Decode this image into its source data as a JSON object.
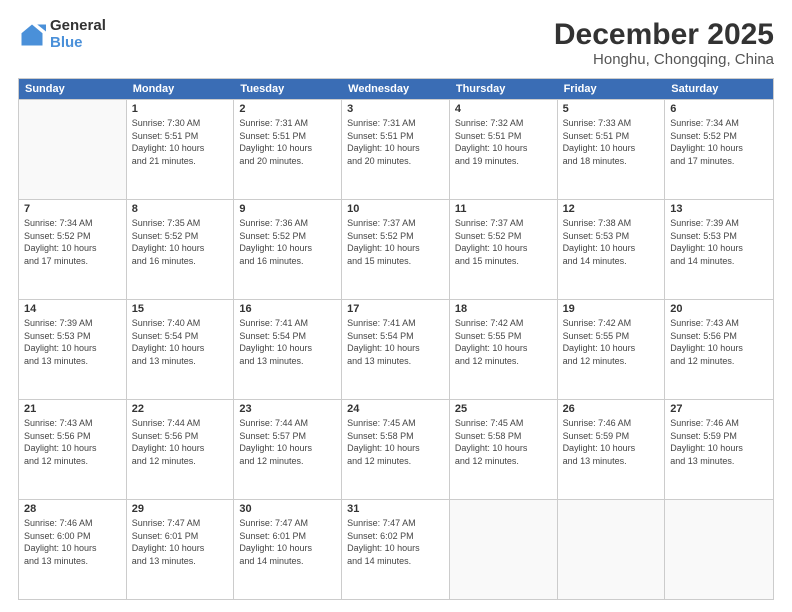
{
  "logo": {
    "general": "General",
    "blue": "Blue"
  },
  "header": {
    "title": "December 2025",
    "subtitle": "Honghu, Chongqing, China"
  },
  "weekdays": [
    "Sunday",
    "Monday",
    "Tuesday",
    "Wednesday",
    "Thursday",
    "Friday",
    "Saturday"
  ],
  "weeks": [
    [
      {
        "day": "",
        "info": ""
      },
      {
        "day": "1",
        "info": "Sunrise: 7:30 AM\nSunset: 5:51 PM\nDaylight: 10 hours\nand 21 minutes."
      },
      {
        "day": "2",
        "info": "Sunrise: 7:31 AM\nSunset: 5:51 PM\nDaylight: 10 hours\nand 20 minutes."
      },
      {
        "day": "3",
        "info": "Sunrise: 7:31 AM\nSunset: 5:51 PM\nDaylight: 10 hours\nand 20 minutes."
      },
      {
        "day": "4",
        "info": "Sunrise: 7:32 AM\nSunset: 5:51 PM\nDaylight: 10 hours\nand 19 minutes."
      },
      {
        "day": "5",
        "info": "Sunrise: 7:33 AM\nSunset: 5:51 PM\nDaylight: 10 hours\nand 18 minutes."
      },
      {
        "day": "6",
        "info": "Sunrise: 7:34 AM\nSunset: 5:52 PM\nDaylight: 10 hours\nand 17 minutes."
      }
    ],
    [
      {
        "day": "7",
        "info": "Sunrise: 7:34 AM\nSunset: 5:52 PM\nDaylight: 10 hours\nand 17 minutes."
      },
      {
        "day": "8",
        "info": "Sunrise: 7:35 AM\nSunset: 5:52 PM\nDaylight: 10 hours\nand 16 minutes."
      },
      {
        "day": "9",
        "info": "Sunrise: 7:36 AM\nSunset: 5:52 PM\nDaylight: 10 hours\nand 16 minutes."
      },
      {
        "day": "10",
        "info": "Sunrise: 7:37 AM\nSunset: 5:52 PM\nDaylight: 10 hours\nand 15 minutes."
      },
      {
        "day": "11",
        "info": "Sunrise: 7:37 AM\nSunset: 5:52 PM\nDaylight: 10 hours\nand 15 minutes."
      },
      {
        "day": "12",
        "info": "Sunrise: 7:38 AM\nSunset: 5:53 PM\nDaylight: 10 hours\nand 14 minutes."
      },
      {
        "day": "13",
        "info": "Sunrise: 7:39 AM\nSunset: 5:53 PM\nDaylight: 10 hours\nand 14 minutes."
      }
    ],
    [
      {
        "day": "14",
        "info": "Sunrise: 7:39 AM\nSunset: 5:53 PM\nDaylight: 10 hours\nand 13 minutes."
      },
      {
        "day": "15",
        "info": "Sunrise: 7:40 AM\nSunset: 5:54 PM\nDaylight: 10 hours\nand 13 minutes."
      },
      {
        "day": "16",
        "info": "Sunrise: 7:41 AM\nSunset: 5:54 PM\nDaylight: 10 hours\nand 13 minutes."
      },
      {
        "day": "17",
        "info": "Sunrise: 7:41 AM\nSunset: 5:54 PM\nDaylight: 10 hours\nand 13 minutes."
      },
      {
        "day": "18",
        "info": "Sunrise: 7:42 AM\nSunset: 5:55 PM\nDaylight: 10 hours\nand 12 minutes."
      },
      {
        "day": "19",
        "info": "Sunrise: 7:42 AM\nSunset: 5:55 PM\nDaylight: 10 hours\nand 12 minutes."
      },
      {
        "day": "20",
        "info": "Sunrise: 7:43 AM\nSunset: 5:56 PM\nDaylight: 10 hours\nand 12 minutes."
      }
    ],
    [
      {
        "day": "21",
        "info": "Sunrise: 7:43 AM\nSunset: 5:56 PM\nDaylight: 10 hours\nand 12 minutes."
      },
      {
        "day": "22",
        "info": "Sunrise: 7:44 AM\nSunset: 5:56 PM\nDaylight: 10 hours\nand 12 minutes."
      },
      {
        "day": "23",
        "info": "Sunrise: 7:44 AM\nSunset: 5:57 PM\nDaylight: 10 hours\nand 12 minutes."
      },
      {
        "day": "24",
        "info": "Sunrise: 7:45 AM\nSunset: 5:58 PM\nDaylight: 10 hours\nand 12 minutes."
      },
      {
        "day": "25",
        "info": "Sunrise: 7:45 AM\nSunset: 5:58 PM\nDaylight: 10 hours\nand 12 minutes."
      },
      {
        "day": "26",
        "info": "Sunrise: 7:46 AM\nSunset: 5:59 PM\nDaylight: 10 hours\nand 13 minutes."
      },
      {
        "day": "27",
        "info": "Sunrise: 7:46 AM\nSunset: 5:59 PM\nDaylight: 10 hours\nand 13 minutes."
      }
    ],
    [
      {
        "day": "28",
        "info": "Sunrise: 7:46 AM\nSunset: 6:00 PM\nDaylight: 10 hours\nand 13 minutes."
      },
      {
        "day": "29",
        "info": "Sunrise: 7:47 AM\nSunset: 6:01 PM\nDaylight: 10 hours\nand 13 minutes."
      },
      {
        "day": "30",
        "info": "Sunrise: 7:47 AM\nSunset: 6:01 PM\nDaylight: 10 hours\nand 14 minutes."
      },
      {
        "day": "31",
        "info": "Sunrise: 7:47 AM\nSunset: 6:02 PM\nDaylight: 10 hours\nand 14 minutes."
      },
      {
        "day": "",
        "info": ""
      },
      {
        "day": "",
        "info": ""
      },
      {
        "day": "",
        "info": ""
      }
    ]
  ]
}
